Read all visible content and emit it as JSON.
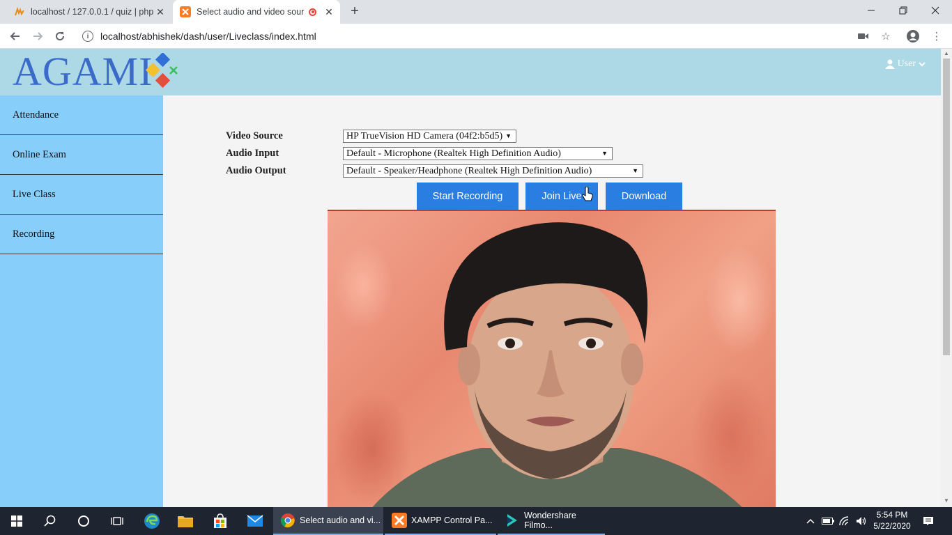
{
  "browser": {
    "tabs": [
      {
        "title": "localhost / 127.0.0.1 / quiz | php"
      },
      {
        "title": "Select audio and video sour"
      }
    ],
    "url": "localhost/abhishek/dash/user/Liveclass/index.html"
  },
  "header": {
    "logo_text": "AGAMI",
    "user_label": "User"
  },
  "sidebar": {
    "items": [
      {
        "label": "Attendance"
      },
      {
        "label": "Online Exam"
      },
      {
        "label": "Live Class"
      },
      {
        "label": "Recording"
      }
    ]
  },
  "form": {
    "video_source": {
      "label": "Video Source",
      "value": "HP TrueVision HD Camera (04f2:b5d5)"
    },
    "audio_input": {
      "label": "Audio Input",
      "value": "Default - Microphone (Realtek High Definition Audio)"
    },
    "audio_output": {
      "label": "Audio Output",
      "value": "Default - Speaker/Headphone (Realtek High Definition Audio)"
    }
  },
  "buttons": {
    "start_recording": "Start Recording",
    "join_live": "Join Live",
    "download": "Download"
  },
  "taskbar": {
    "apps": [
      {
        "label": "Select audio and vi..."
      },
      {
        "label": "XAMPP Control Pa..."
      },
      {
        "label": "Wondershare Filmo..."
      }
    ],
    "time": "5:54 PM",
    "date": "5/22/2020"
  },
  "colors": {
    "header_bg": "#add8e6",
    "sidebar_bg": "#87cefa",
    "button_bg": "#2a7de1",
    "logo_text": "#3b6bc9"
  }
}
